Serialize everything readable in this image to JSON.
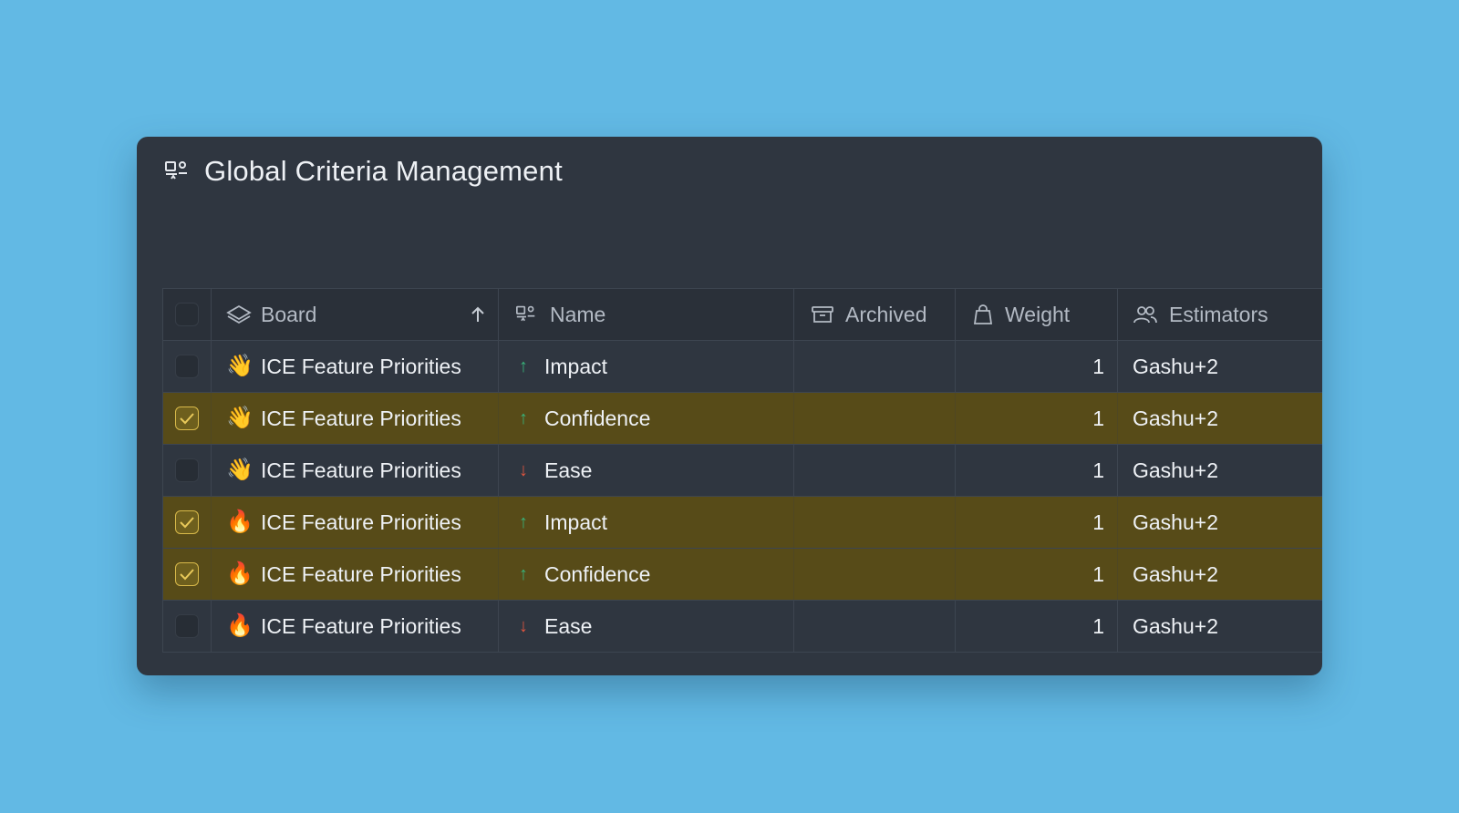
{
  "header": {
    "title": "Global Criteria Management",
    "icon": "criteria-icon"
  },
  "table": {
    "columns": [
      {
        "key": "board",
        "label": "Board",
        "icon": "layers-icon"
      },
      {
        "key": "name",
        "label": "Name",
        "icon": "criteria-icon"
      },
      {
        "key": "archived",
        "label": "Archived",
        "icon": "archive-icon"
      },
      {
        "key": "weight",
        "label": "Weight",
        "icon": "weight-icon"
      },
      {
        "key": "estimators",
        "label": "Estimators",
        "icon": "users-icon"
      }
    ],
    "sort": {
      "column": "board",
      "direction": "ascending",
      "icon": "arrow-up-icon"
    },
    "rows": [
      {
        "selected": false,
        "board_emoji": "👋",
        "board": "ICE Feature Priorities",
        "direction": "up",
        "name": "Impact",
        "archived": "",
        "weight": "1",
        "estimators": "Gashu+2"
      },
      {
        "selected": true,
        "board_emoji": "👋",
        "board": "ICE Feature Priorities",
        "direction": "up",
        "name": "Confidence",
        "archived": "",
        "weight": "1",
        "estimators": "Gashu+2"
      },
      {
        "selected": false,
        "board_emoji": "👋",
        "board": "ICE Feature Priorities",
        "direction": "down",
        "name": "Ease",
        "archived": "",
        "weight": "1",
        "estimators": "Gashu+2"
      },
      {
        "selected": true,
        "board_emoji": "🔥",
        "board": "ICE Feature Priorities",
        "direction": "up",
        "name": "Impact",
        "archived": "",
        "weight": "1",
        "estimators": "Gashu+2"
      },
      {
        "selected": true,
        "board_emoji": "🔥",
        "board": "ICE Feature Priorities",
        "direction": "up",
        "name": "Confidence",
        "archived": "",
        "weight": "1",
        "estimators": "Gashu+2"
      },
      {
        "selected": false,
        "board_emoji": "🔥",
        "board": "ICE Feature Priorities",
        "direction": "down",
        "name": "Ease",
        "archived": "",
        "weight": "1",
        "estimators": "Gashu+2"
      }
    ]
  },
  "colors": {
    "background": "#62b9e4",
    "card": "#2f3640",
    "selected_row": "#574b18",
    "arrow_up": "#38b27a",
    "arrow_down": "#e0553f",
    "checkbox_selected_border": "#d8b94a"
  }
}
